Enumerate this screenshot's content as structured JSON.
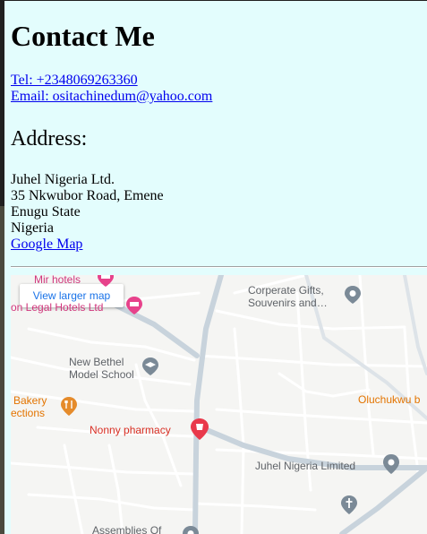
{
  "contact": {
    "heading": "Contact Me",
    "tel": "Tel: +2348069263360",
    "email": "Email: ositachinedum@yahoo.com",
    "address_heading": "Address:",
    "address_lines": [
      "Juhel Nigeria Ltd.",
      "35 Nkwubor Road, Emene",
      "Enugu State",
      "Nigeria"
    ],
    "map_link": "Google Map"
  },
  "map": {
    "larger_map": "View larger map",
    "places": {
      "mir_hotels": "Mir hotels",
      "legal_hotels": "on Legal Hotels Ltd",
      "corporate_gifts_1": "Corperate Gifts,",
      "corporate_gifts_2": "Souvenirs and…",
      "new_bethel_1": "New Bethel",
      "new_bethel_2": "Model School",
      "bakery_1": "Bakery",
      "bakery_2": "ections",
      "oluchukwu": "Oluchukwu b",
      "nonny": "Nonny pharmacy",
      "juhel": "Juhel Nigeria Limited",
      "assemblies": "Assemblies Of"
    },
    "icons": {
      "hotel": "hotel-pin-icon",
      "school": "school-pin-icon",
      "restaurant": "restaurant-pin-icon",
      "pharmacy": "pharmacy-pin-icon",
      "place": "place-pin-icon",
      "church": "church-pin-icon"
    },
    "colors": {
      "hotel": "#e7428b",
      "place": "#7b8a97",
      "restaurant": "#e58b2b",
      "pharmacy": "#e9394b",
      "link": "#0000ee",
      "panel_bg": "#e3fdfd"
    }
  }
}
